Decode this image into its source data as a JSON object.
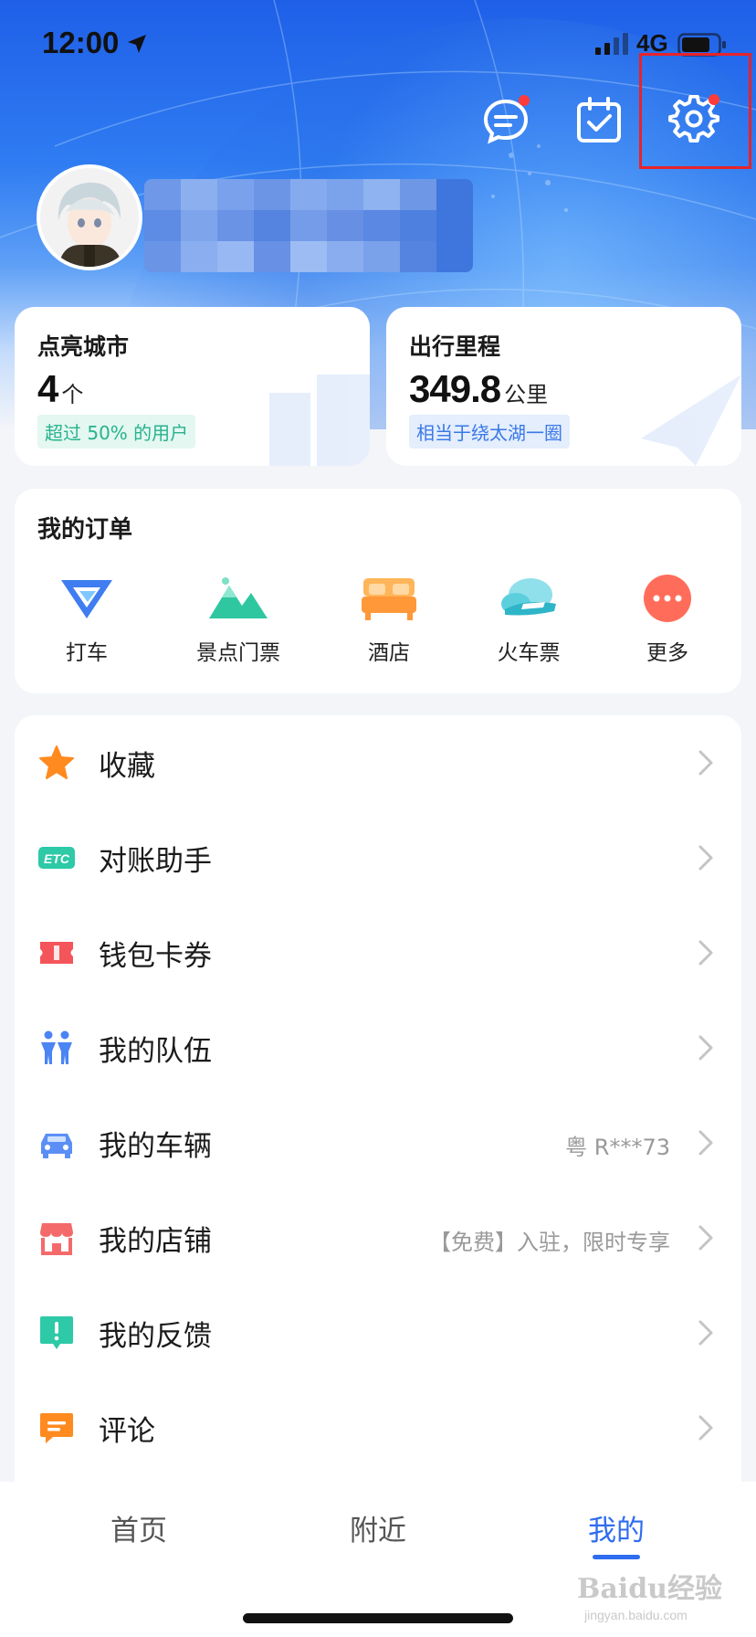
{
  "status_bar": {
    "time": "12:00",
    "network": "4G"
  },
  "stats": [
    {
      "title": "点亮城市",
      "value": "4",
      "unit": "个",
      "tag": "超过 50% 的用户"
    },
    {
      "title": "出行里程",
      "value": "349.8",
      "unit": "公里",
      "tag": "相当于绕太湖一圈"
    }
  ],
  "orders": {
    "title": "我的订单",
    "items": [
      {
        "label": "打车",
        "icon": "taxi-icon"
      },
      {
        "label": "景点门票",
        "icon": "mountain-icon"
      },
      {
        "label": "酒店",
        "icon": "bed-icon"
      },
      {
        "label": "火车票",
        "icon": "train-icon"
      },
      {
        "label": "更多",
        "icon": "more-icon"
      }
    ]
  },
  "menu": [
    {
      "label": "收藏",
      "value": "",
      "icon": "star-icon",
      "color": "#ff8a1f"
    },
    {
      "label": "对账助手",
      "value": "",
      "icon": "etc-icon",
      "color": "#2ec9a7"
    },
    {
      "label": "钱包卡券",
      "value": "",
      "icon": "ticket-icon",
      "color": "#f4555a"
    },
    {
      "label": "我的队伍",
      "value": "",
      "icon": "team-icon",
      "color": "#4b84f3"
    },
    {
      "label": "我的车辆",
      "value": "粤 R***73",
      "icon": "car-icon",
      "color": "#5b8ff5"
    },
    {
      "label": "我的店铺",
      "value": "【免费】入驻，限时专享",
      "icon": "store-icon",
      "color": "#f46a6a"
    },
    {
      "label": "我的反馈",
      "value": "",
      "icon": "feedback-icon",
      "color": "#2ec9a7"
    },
    {
      "label": "评论",
      "value": "",
      "icon": "comment-icon",
      "color": "#ff8a1f"
    }
  ],
  "tabs": [
    {
      "label": "首页"
    },
    {
      "label": "附近"
    },
    {
      "label": "我的"
    }
  ],
  "watermark": {
    "main": "Baidu经验",
    "sub": "jingyan.baidu.com"
  },
  "colors": {
    "accent": "#2f6df0",
    "alert": "#ff3b3b",
    "highlight": "#e8232a"
  }
}
